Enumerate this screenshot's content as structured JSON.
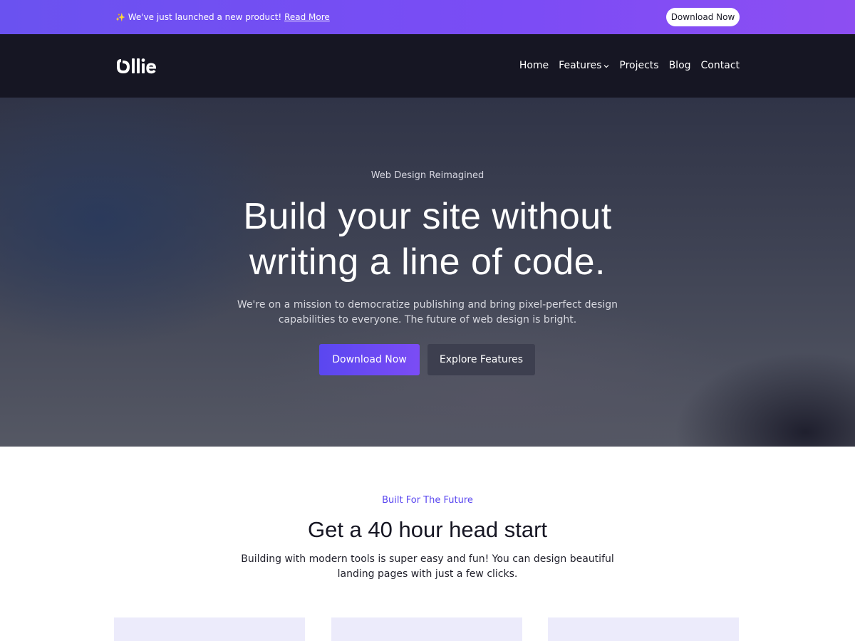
{
  "announcement": {
    "spark_icon": "✨",
    "message": "We've just launched a new product!",
    "link_label": "Read More",
    "button_label": "Download Now"
  },
  "nav": {
    "logo_text": "ollie",
    "links": [
      {
        "label": "Home"
      },
      {
        "label": "Features",
        "has_dropdown": true,
        "dropdown_icon": "chevron-down-icon"
      },
      {
        "label": "Projects"
      },
      {
        "label": "Blog"
      },
      {
        "label": "Contact"
      }
    ]
  },
  "hero": {
    "eyebrow": "Web Design Reimagined",
    "title_line1": "Build your site without",
    "title_line2": "writing a line of code.",
    "subtitle": "We're on a mission to democratize publishing and bring pixel-perfect design capabilities to everyone. The future of web design is bright.",
    "primary_button": "Download Now",
    "secondary_button": "Explore Features"
  },
  "features": {
    "eyebrow": "Built For The Future",
    "title": "Get a 40 hour head start",
    "subtitle": "Building with modern tools is super easy and fun! You can design beautiful landing pages with just a few clicks."
  },
  "colors": {
    "accent": "#5a47f0",
    "announcement_gradient_start": "#6a52f0",
    "announcement_gradient_end": "#8d4ef2",
    "nav_background": "#161623",
    "card_background": "#ecebfb"
  }
}
